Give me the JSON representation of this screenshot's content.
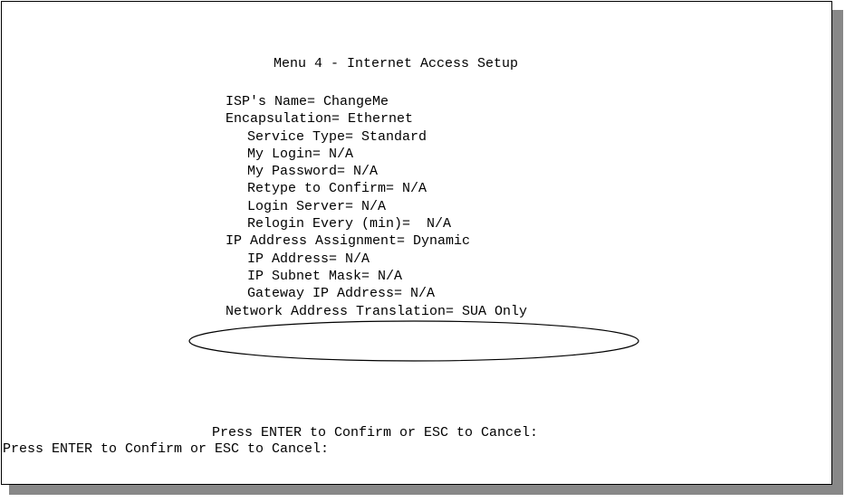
{
  "menu": {
    "title": "Menu 4 - Internet Access Setup"
  },
  "fields": {
    "isp_name": "ISP's Name= ChangeMe",
    "encapsulation": "Encapsulation= Ethernet",
    "service_type": "Service Type= Standard",
    "my_login": "My Login= N/A",
    "my_password": "My Password= N/A",
    "retype_confirm": "Retype to Confirm= N/A",
    "login_server": "Login Server= N/A",
    "relogin_every": "Relogin Every (min)=  N/A",
    "ip_assignment": "IP Address Assignment= Dynamic",
    "ip_address": "IP Address= N/A",
    "ip_subnet_mask": "IP Subnet Mask= N/A",
    "gateway_ip": "Gateway IP Address= N/A",
    "nat": "Network Address Translation= SUA Only"
  },
  "prompts": {
    "confirm_primary": "Press ENTER to Confirm or ESC to Cancel:",
    "confirm_secondary": "Press ENTER to Confirm or ESC to Cancel:"
  },
  "colors": {
    "background": "#ffffff",
    "text": "#000000",
    "shadow": "#888888"
  }
}
